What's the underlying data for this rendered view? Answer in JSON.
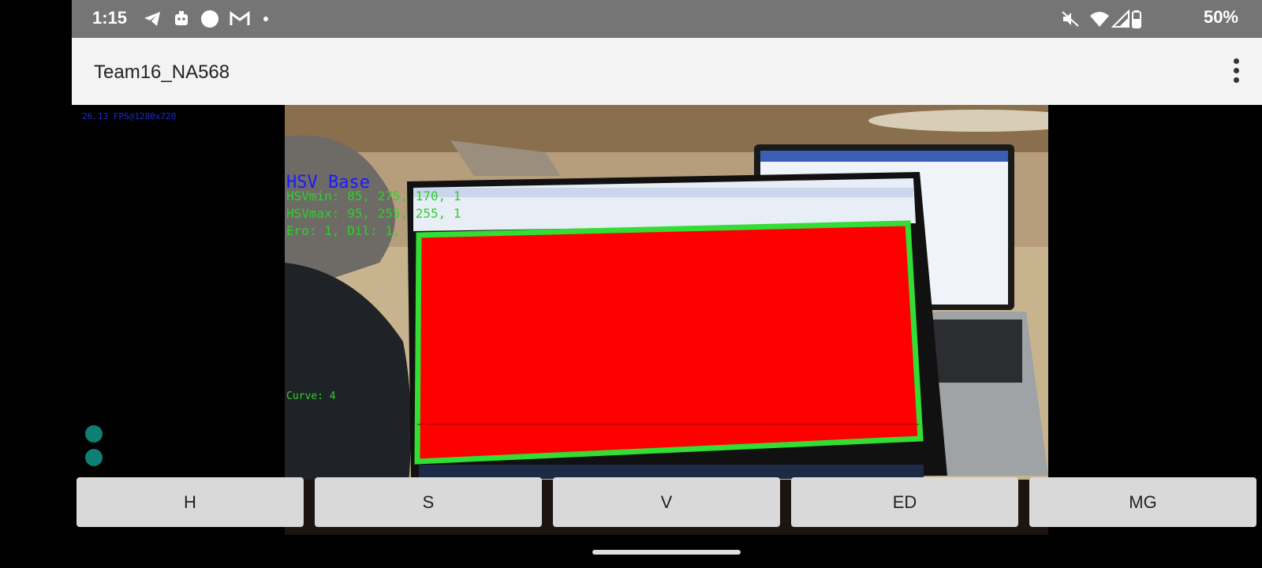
{
  "status_bar": {
    "time": "1:15",
    "battery": "50%",
    "icons_left": [
      "telegram-icon",
      "notification-icon",
      "circle-icon",
      "gmail-icon",
      "dot-icon"
    ],
    "icons_right": [
      "mute-icon",
      "wifi-icon",
      "signal-icon",
      "battery-icon"
    ]
  },
  "app_bar": {
    "title": "Team16_NA568"
  },
  "camera_overlay": {
    "fps": "26.13 FPS@1280x720",
    "hsv_base": "HSV Base",
    "hsv_min": "HSVmin:   85,  275,  170,  1",
    "hsv_max": "HSVmax:   95,  255,  255,  1",
    "erode_dilate": "Ero: 1,  Dil: 1,",
    "curve": "Curve:  4"
  },
  "buttons": [
    {
      "label": "H"
    },
    {
      "label": "S"
    },
    {
      "label": "V"
    },
    {
      "label": "ED"
    },
    {
      "label": "MG"
    }
  ],
  "colors": {
    "status_bar_bg": "#757575",
    "app_bar_bg": "#f3f3f3",
    "mask_fill": "#ff0000",
    "contour": "#33dd33",
    "dot": "#0f7f73"
  }
}
